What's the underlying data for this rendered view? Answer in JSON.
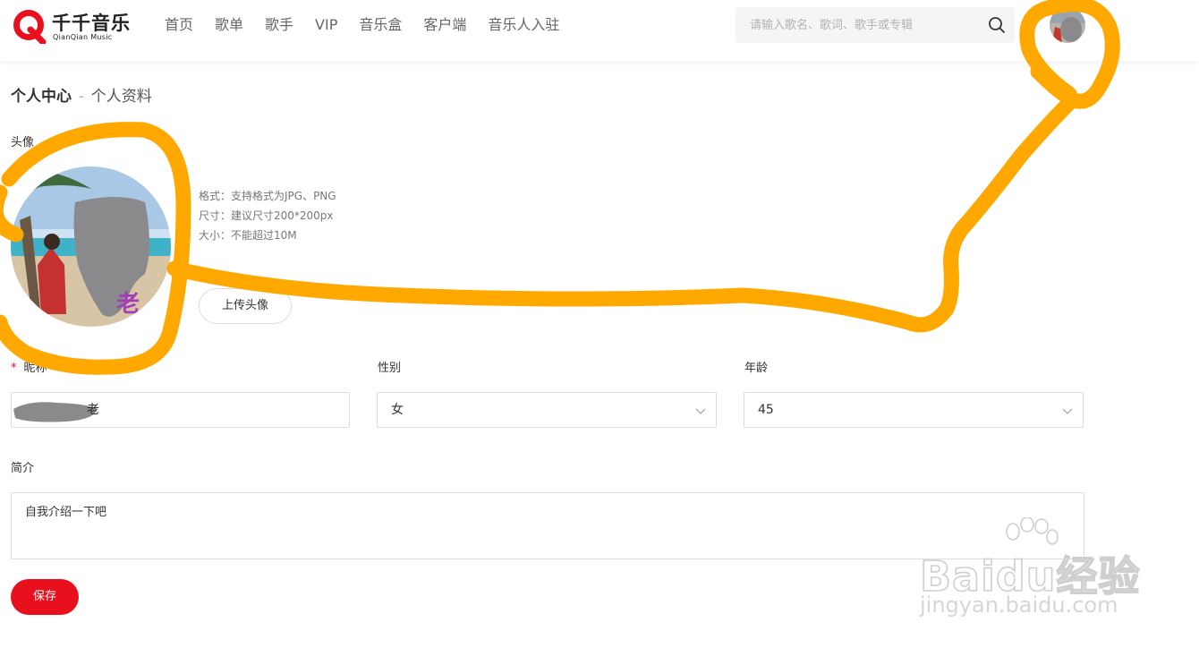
{
  "header": {
    "logo_cn": "千千音乐",
    "logo_en": "QianQian Music",
    "nav": [
      "首页",
      "歌单",
      "歌手",
      "VIP",
      "音乐盒",
      "客户端",
      "音乐人入驻"
    ],
    "search_placeholder": "请输入歌名、歌词、歌手或专辑",
    "search_icon": "search-icon"
  },
  "page": {
    "title": "个人中心",
    "separator": "-",
    "subtitle": "个人资料"
  },
  "avatar_section": {
    "label": "头像",
    "tips": [
      "格式：支持格式为JPG、PNG",
      "尺寸：建议尺寸200*200px",
      "大小：不能超过10M"
    ],
    "upload_label": "上传头像",
    "avatar_overlay_text": "老"
  },
  "form": {
    "required_mark": "*",
    "nickname_label": "昵称",
    "nickname_value": "老",
    "gender_label": "性别",
    "gender_value": "女",
    "age_label": "年龄",
    "age_value": "45",
    "bio_label": "简介",
    "bio_placeholder": "自我介绍一下吧",
    "save_label": "保存"
  },
  "watermark": {
    "brand": "Baidu经验",
    "url": "jingyan.baidu.com"
  },
  "colors": {
    "brand_red": "#e8101c",
    "annotation_orange": "#ffa800",
    "redaction_gray": "#8a8a8d"
  }
}
